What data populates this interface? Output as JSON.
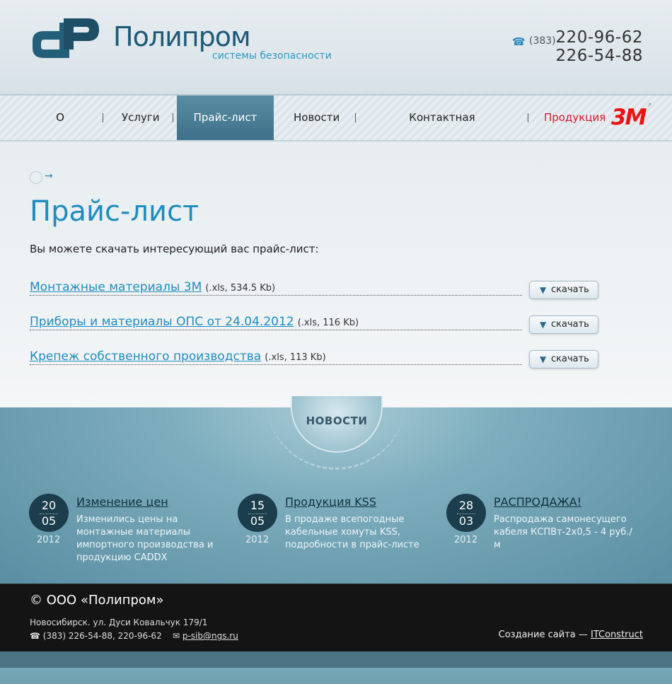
{
  "header": {
    "company_name": "Полипром",
    "tagline": "системы безопасности",
    "phone_code": "(383)",
    "phone_1": "220-96-62",
    "phone_2": "226-54-88",
    "phone_icon": "phone-icon"
  },
  "nav": {
    "items": [
      {
        "label": "О компании"
      },
      {
        "label": "Услуги"
      },
      {
        "label": "Прайс-лист",
        "active": true
      },
      {
        "label": "Новости"
      },
      {
        "label": "Контактная информация"
      },
      {
        "label": "Продукция"
      }
    ],
    "brand_logo": "3M"
  },
  "main": {
    "title": "Прайс-лист",
    "intro": "Вы можете скачать интересующий вас прайс-лист:",
    "price_lists": [
      {
        "name": "Монтажные материалы 3М",
        "meta": "(.xls, 534.5 Kb)",
        "button": "скачать"
      },
      {
        "name": "Приборы и материалы ОПС от 24.04.2012",
        "meta": "(.xls, 116 Kb)",
        "button": "скачать"
      },
      {
        "name": "Крепеж собственного производства",
        "meta": "(.xls, 113 Kb)",
        "button": "скачать"
      }
    ]
  },
  "news": {
    "heading": "НОВОСТИ",
    "items": [
      {
        "day": "20",
        "month": "05",
        "year": "2012",
        "title": "Изменение цен",
        "text": "Изменились цены на монтажные материалы импортного производства и продукцию CADDX"
      },
      {
        "day": "15",
        "month": "05",
        "year": "2012",
        "title": "Продукция KSS",
        "text": "В продаже всепогодные кабельные хомуты KSS, подробности в прайс-листе"
      },
      {
        "day": "28",
        "month": "03",
        "year": "2012",
        "title": "РАСПРОДАЖА!",
        "text": "Распродажа самонесущего кабеля КСПВт-2х0,5 - 4 руб./м"
      }
    ]
  },
  "footer": {
    "copyright": "© ООО «Полипром»",
    "address": "Новосибирск. ул. Дуси Ковальчук 179/1",
    "phones": "(383) 226-54-88, 220-96-62",
    "email": "p-sib@ngs.ru",
    "credit_prefix": "Создание сайта —",
    "credit_link": "ITConstruct"
  },
  "colors": {
    "accent": "#1f8cc0",
    "nav_active": "#4a7e96",
    "brand_red": "#d8192a",
    "footer_bg": "#141414"
  }
}
